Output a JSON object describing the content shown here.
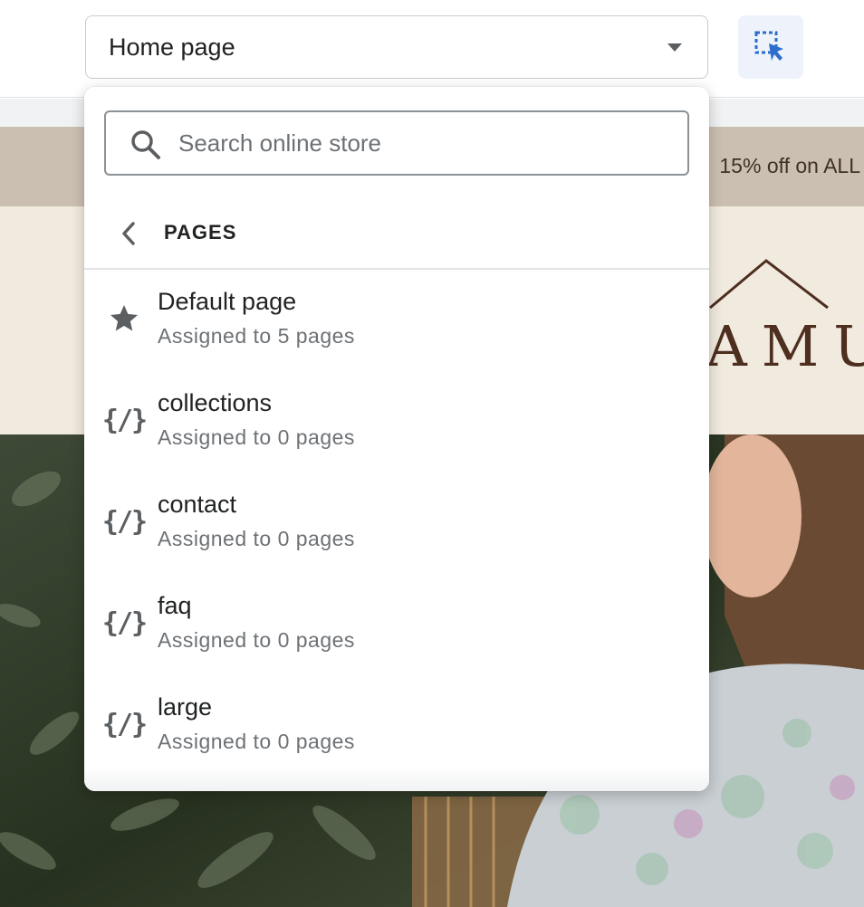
{
  "topbar": {
    "page_select_value": "Home page",
    "inspect_icon": "select-cursor-icon",
    "accent_color": "#2c6ecb"
  },
  "store": {
    "announcement_text": "15% off on ALL",
    "logo_text": "AMU"
  },
  "popover": {
    "search_placeholder": "Search online store",
    "section_title": "PAGES",
    "items": [
      {
        "icon": "star-icon",
        "title": "Default page",
        "subtitle": "Assigned to 5 pages"
      },
      {
        "icon": "code-icon",
        "title": "collections",
        "subtitle": "Assigned to 0 pages"
      },
      {
        "icon": "code-icon",
        "title": "contact",
        "subtitle": "Assigned to 0 pages"
      },
      {
        "icon": "code-icon",
        "title": "faq",
        "subtitle": "Assigned to 0 pages"
      },
      {
        "icon": "code-icon",
        "title": "large",
        "subtitle": "Assigned to 0 pages"
      }
    ],
    "code_glyph": "{/}"
  }
}
